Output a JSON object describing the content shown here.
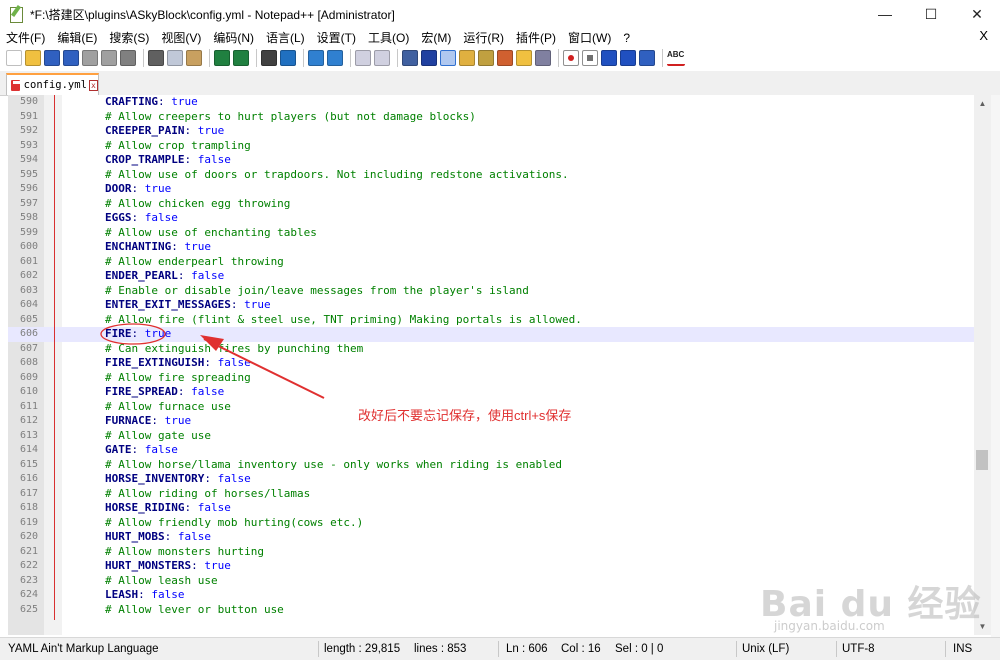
{
  "window": {
    "title": "*F:\\搭建区\\plugins\\ASkyBlock\\config.yml - Notepad++ [Administrator]",
    "minimize_glyph": "—",
    "maximize_glyph": "☐",
    "close_glyph": "✕"
  },
  "menu": {
    "items": [
      "文件(F)",
      "编辑(E)",
      "搜索(S)",
      "视图(V)",
      "编码(N)",
      "语言(L)",
      "设置(T)",
      "工具(O)",
      "宏(M)",
      "运行(R)",
      "插件(P)",
      "窗口(W)",
      "?"
    ],
    "close_doc": "X"
  },
  "toolbar": {
    "icons": [
      "new-file-icon",
      "open-file-icon",
      "save-icon",
      "save-all-icon",
      "close-icon",
      "close-all-icon",
      "print-icon",
      "sep",
      "cut-icon",
      "copy-icon",
      "paste-icon",
      "sep",
      "undo-icon",
      "redo-icon",
      "sep",
      "find-icon",
      "replace-icon",
      "sep",
      "zoom-in-icon",
      "zoom-out-icon",
      "sep",
      "sync-vertical-icon",
      "sync-horizontal-icon",
      "sep",
      "word-wrap-icon",
      "show-all-chars-icon",
      "indent-guide-icon",
      "user-language-icon",
      "doc-map-icon",
      "function-list-icon",
      "folder-workspace-icon",
      "monitoring-icon",
      "sep",
      "record-macro-icon",
      "stop-record-icon",
      "play-macro-icon",
      "run-macro-multiple-icon",
      "save-macro-icon",
      "sep",
      "spellcheck-icon"
    ],
    "spellcheck_label": "ABC"
  },
  "tab": {
    "label": "config.yml",
    "close_glyph": "x"
  },
  "editor": {
    "lines": [
      {
        "n": "590",
        "type": "kv",
        "key": "CRAFTING",
        "val": "true"
      },
      {
        "n": "591",
        "type": "comment",
        "text": "# Allow creepers to hurt players (but not damage blocks)"
      },
      {
        "n": "592",
        "type": "kv",
        "key": "CREEPER_PAIN",
        "val": "true"
      },
      {
        "n": "593",
        "type": "comment",
        "text": "# Allow crop trampling"
      },
      {
        "n": "594",
        "type": "kv",
        "key": "CROP_TRAMPLE",
        "val": "false"
      },
      {
        "n": "595",
        "type": "comment",
        "text": "# Allow use of doors or trapdoors. Not including redstone activations."
      },
      {
        "n": "596",
        "type": "kv",
        "key": "DOOR",
        "val": "true"
      },
      {
        "n": "597",
        "type": "comment",
        "text": "# Allow chicken egg throwing"
      },
      {
        "n": "598",
        "type": "kv",
        "key": "EGGS",
        "val": "false"
      },
      {
        "n": "599",
        "type": "comment",
        "text": "# Allow use of enchanting tables"
      },
      {
        "n": "600",
        "type": "kv",
        "key": "ENCHANTING",
        "val": "true"
      },
      {
        "n": "601",
        "type": "comment",
        "text": "# Allow enderpearl throwing"
      },
      {
        "n": "602",
        "type": "kv",
        "key": "ENDER_PEARL",
        "val": "false"
      },
      {
        "n": "603",
        "type": "comment",
        "text": "# Enable or disable join/leave messages from the player's island"
      },
      {
        "n": "604",
        "type": "kv",
        "key": "ENTER_EXIT_MESSAGES",
        "val": "true"
      },
      {
        "n": "605",
        "type": "comment",
        "text": "# Allow fire (flint & steel use, TNT priming) Making portals is allowed."
      },
      {
        "n": "606",
        "type": "kv",
        "key": "FIRE",
        "val": "true",
        "current": true
      },
      {
        "n": "607",
        "type": "comment",
        "text": "# Can extinguish fires by punching them"
      },
      {
        "n": "608",
        "type": "kv",
        "key": "FIRE_EXTINGUISH",
        "val": "false"
      },
      {
        "n": "609",
        "type": "comment",
        "text": "# Allow fire spreading"
      },
      {
        "n": "610",
        "type": "kv",
        "key": "FIRE_SPREAD",
        "val": "false"
      },
      {
        "n": "611",
        "type": "comment",
        "text": "# Allow furnace use"
      },
      {
        "n": "612",
        "type": "kv",
        "key": "FURNACE",
        "val": "true"
      },
      {
        "n": "613",
        "type": "comment",
        "text": "# Allow gate use"
      },
      {
        "n": "614",
        "type": "kv",
        "key": "GATE",
        "val": "false"
      },
      {
        "n": "615",
        "type": "comment",
        "text": "# Allow horse/llama inventory use - only works when riding is enabled"
      },
      {
        "n": "616",
        "type": "kv",
        "key": "HORSE_INVENTORY",
        "val": "false"
      },
      {
        "n": "617",
        "type": "comment",
        "text": "# Allow riding of horses/llamas"
      },
      {
        "n": "618",
        "type": "kv",
        "key": "HORSE_RIDING",
        "val": "false"
      },
      {
        "n": "619",
        "type": "comment",
        "text": "# Allow friendly mob hurting(cows etc.)"
      },
      {
        "n": "620",
        "type": "kv",
        "key": "HURT_MOBS",
        "val": "false"
      },
      {
        "n": "621",
        "type": "comment",
        "text": "# Allow monsters hurting"
      },
      {
        "n": "622",
        "type": "kv",
        "key": "HURT_MONSTERS",
        "val": "true"
      },
      {
        "n": "623",
        "type": "comment",
        "text": "# Allow leash use"
      },
      {
        "n": "624",
        "type": "kv",
        "key": "LEASH",
        "val": "false"
      },
      {
        "n": "625",
        "type": "comment",
        "text": "# Allow lever or button use"
      }
    ]
  },
  "annotation": {
    "text": "改好后不要忘记保存，使用ctrl+s保存",
    "color": "#e03030"
  },
  "statusbar": {
    "language": "YAML Ain't Markup Language",
    "length": "length : 29,815",
    "lines": "lines : 853",
    "ln": "Ln : 606",
    "col": "Col : 16",
    "sel": "Sel : 0 | 0",
    "eol": "Unix (LF)",
    "encoding": "UTF-8",
    "mode": "INS"
  },
  "watermark": {
    "brand": "Bai du 经验",
    "url": "jingyan.baidu.com"
  }
}
